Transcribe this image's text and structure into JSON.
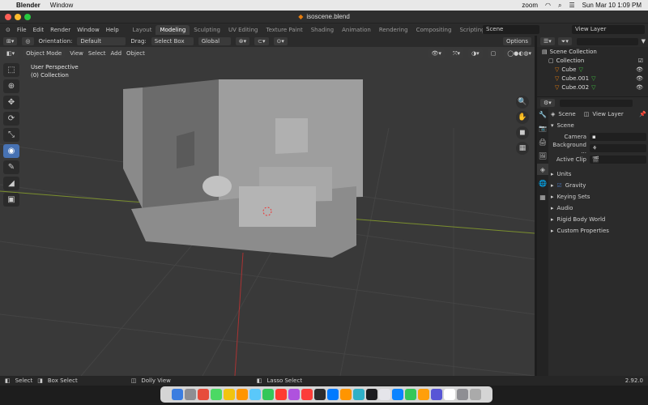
{
  "mac": {
    "app": "Blender",
    "window": "Window",
    "zoom": "zoom",
    "clock": "Sun Mar 10  1:09 PM"
  },
  "title": "isoscene.blend",
  "menu": [
    "File",
    "Edit",
    "Render",
    "Window",
    "Help"
  ],
  "workspaces": [
    "Layout",
    "Modeling",
    "Sculpting",
    "UV Editing",
    "Texture Paint",
    "Shading",
    "Animation",
    "Rendering",
    "Compositing",
    "Scripting"
  ],
  "active_workspace": "Modeling",
  "scene": "Scene",
  "view_layer": "View Layer",
  "tool_header": {
    "orientation_label": "Orientation:",
    "orientation": "Default",
    "drag_label": "Drag:",
    "drag": "Select Box",
    "transform": "Global",
    "options": "Options"
  },
  "viewport_header": {
    "mode": "Object Mode",
    "menus": [
      "View",
      "Select",
      "Add",
      "Object"
    ]
  },
  "overlay_text": [
    "User Perspective",
    "(0) Collection"
  ],
  "outliner": {
    "rows": [
      "Scene Collection",
      "Collection",
      "Cube",
      "Cube.001",
      "Cube.002"
    ]
  },
  "properties": {
    "scene_name": "Scene",
    "view_layer": "View Layer",
    "panel": "Scene",
    "fields": [
      {
        "label": "Camera"
      },
      {
        "label": "Background ..."
      },
      {
        "label": "Active Clip"
      }
    ],
    "sections": [
      "Units",
      "Gravity",
      "Keying Sets",
      "Audio",
      "Rigid Body World",
      "Custom Properties"
    ]
  },
  "status": {
    "items": [
      "Select",
      "Box Select",
      "Dolly View",
      "Lasso Select"
    ],
    "version": "2.92.0"
  },
  "dock_colors": [
    "#3b7de0",
    "#8e8e93",
    "#e74c3c",
    "#4cd964",
    "#f1c40f",
    "#ff9500",
    "#5ac8fa",
    "#34c759",
    "#ff3b30",
    "#af52de",
    "#fc3d39",
    "#2c2c2e",
    "#007aff",
    "#ff9500",
    "#30b0c7",
    "#1c1c1e",
    "#e5e5ea",
    "#0a84ff",
    "#34c759",
    "#ff9f0a",
    "#5856d6",
    "#ffffff",
    "#8e8e93",
    "#aaaaaa"
  ]
}
